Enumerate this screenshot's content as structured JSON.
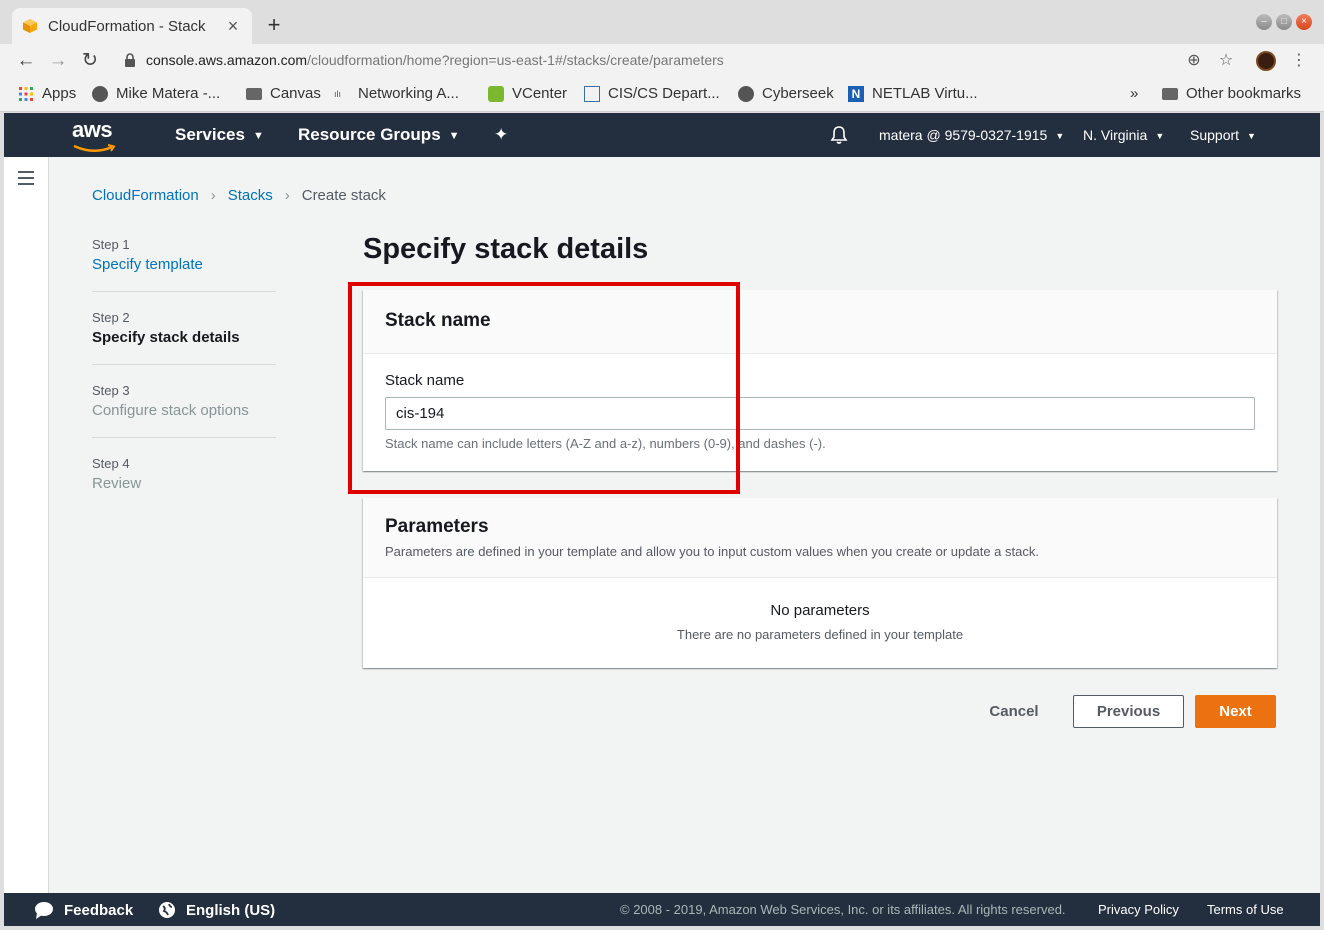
{
  "browser": {
    "tab_title": "CloudFormation - Stack",
    "url_host": "console.aws.amazon.com",
    "url_path": "/cloudformation/home?region=us-east-1#/stacks/create/parameters",
    "bookmarks": [
      "Apps",
      "Mike Matera -...",
      "Canvas",
      "Networking A...",
      "VCenter",
      "CIS/CS Depart...",
      "Cyberseek",
      "NETLAB Virtu..."
    ],
    "bookmarks_overflow": "»",
    "other_bookmarks": "Other bookmarks"
  },
  "aws_nav": {
    "logo_text": "aws",
    "services": "Services",
    "resource_groups": "Resource Groups",
    "account": "matera @ 9579-0327-1915",
    "region": "N. Virginia",
    "support": "Support"
  },
  "breadcrumb": {
    "item1": "CloudFormation",
    "item2": "Stacks",
    "item3": "Create stack"
  },
  "steps": [
    {
      "num": "Step 1",
      "label": "Specify template"
    },
    {
      "num": "Step 2",
      "label": "Specify stack details"
    },
    {
      "num": "Step 3",
      "label": "Configure stack options"
    },
    {
      "num": "Step 4",
      "label": "Review"
    }
  ],
  "page_title": "Specify stack details",
  "stack_name_panel": {
    "title": "Stack name",
    "field_label": "Stack name",
    "value": "cis-194",
    "hint": "Stack name can include letters (A-Z and a-z), numbers (0-9), and dashes (-)."
  },
  "parameters_panel": {
    "title": "Parameters",
    "description": "Parameters are defined in your template and allow you to input custom values when you create or update a stack.",
    "empty_title": "No parameters",
    "empty_desc": "There are no parameters defined in your template"
  },
  "actions": {
    "cancel": "Cancel",
    "previous": "Previous",
    "next": "Next"
  },
  "footer": {
    "feedback": "Feedback",
    "language": "English (US)",
    "copyright": "© 2008 - 2019, Amazon Web Services, Inc. or its affiliates. All rights reserved.",
    "privacy": "Privacy Policy",
    "terms": "Terms of Use"
  },
  "colors": {
    "aws_nav_bg": "#232f3e",
    "link": "#0073bb",
    "primary_button": "#ec7211",
    "highlight_box": "#e00000"
  }
}
